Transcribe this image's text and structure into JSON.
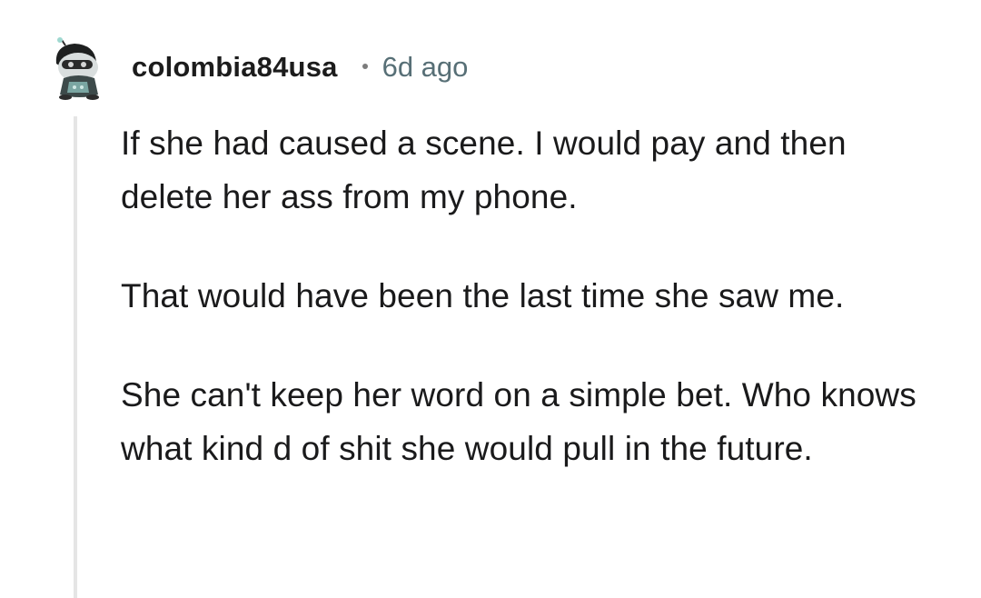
{
  "comment": {
    "author": "colombia84usa",
    "timestamp": "6d ago",
    "avatar_icon": "snoo-avatar-icon",
    "paragraphs": [
      "If she had caused a scene. I would pay and then delete her ass from my phone.",
      "That would have been the last time she saw me.",
      "She can't keep her word on a simple bet. Who knows what kind d of shit she would pull in the future."
    ]
  },
  "colors": {
    "text": "#1a1a1b",
    "meta": "#576f76",
    "thread_line": "#e5e5e5"
  }
}
